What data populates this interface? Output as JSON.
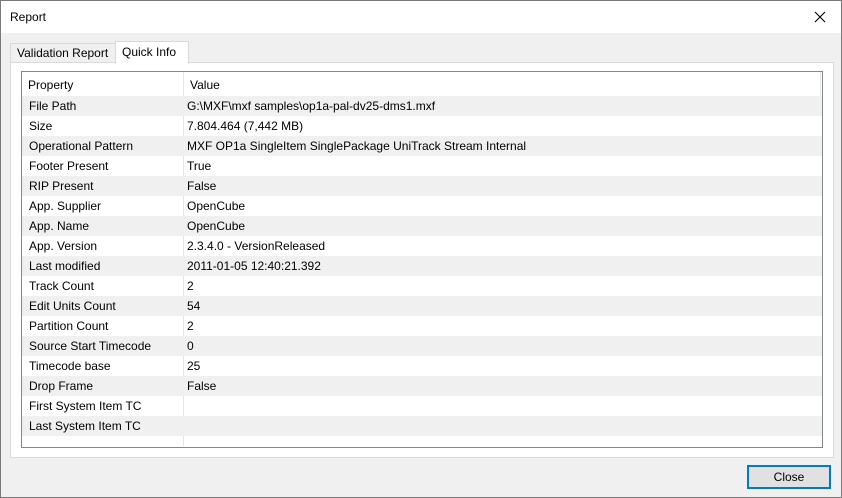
{
  "window": {
    "title": "Report"
  },
  "tabs": [
    {
      "label": "Validation Report",
      "active": false
    },
    {
      "label": "Quick Info",
      "active": true
    }
  ],
  "list": {
    "headers": {
      "property": "Property",
      "value": "Value"
    },
    "rows": [
      {
        "property": "File Path",
        "value": "G:\\MXF\\mxf samples\\op1a-pal-dv25-dms1.mxf"
      },
      {
        "property": "Size",
        "value": "7.804.464 (7,442 MB)"
      },
      {
        "property": "Operational Pattern",
        "value": "MXF OP1a SingleItem SinglePackage UniTrack Stream Internal"
      },
      {
        "property": "Footer Present",
        "value": "True"
      },
      {
        "property": "RIP Present",
        "value": "False"
      },
      {
        "property": "App. Supplier",
        "value": "OpenCube"
      },
      {
        "property": "App. Name",
        "value": "OpenCube"
      },
      {
        "property": "App. Version",
        "value": "2.3.4.0 - VersionReleased"
      },
      {
        "property": "Last modified",
        "value": "2011-01-05  12:40:21.392"
      },
      {
        "property": "Track Count",
        "value": "2"
      },
      {
        "property": "Edit Units Count",
        "value": "54"
      },
      {
        "property": "Partition Count",
        "value": "2"
      },
      {
        "property": "Source Start Timecode",
        "value": "0"
      },
      {
        "property": "Timecode base",
        "value": "25"
      },
      {
        "property": "Drop Frame",
        "value": "False"
      },
      {
        "property": "First System Item TC",
        "value": ""
      },
      {
        "property": "Last System Item TC",
        "value": ""
      }
    ]
  },
  "buttons": {
    "close": "Close"
  },
  "icons": {
    "close": "close-icon"
  },
  "colors": {
    "accent": "#0078d7",
    "alt_row": "#f0f0f0"
  }
}
